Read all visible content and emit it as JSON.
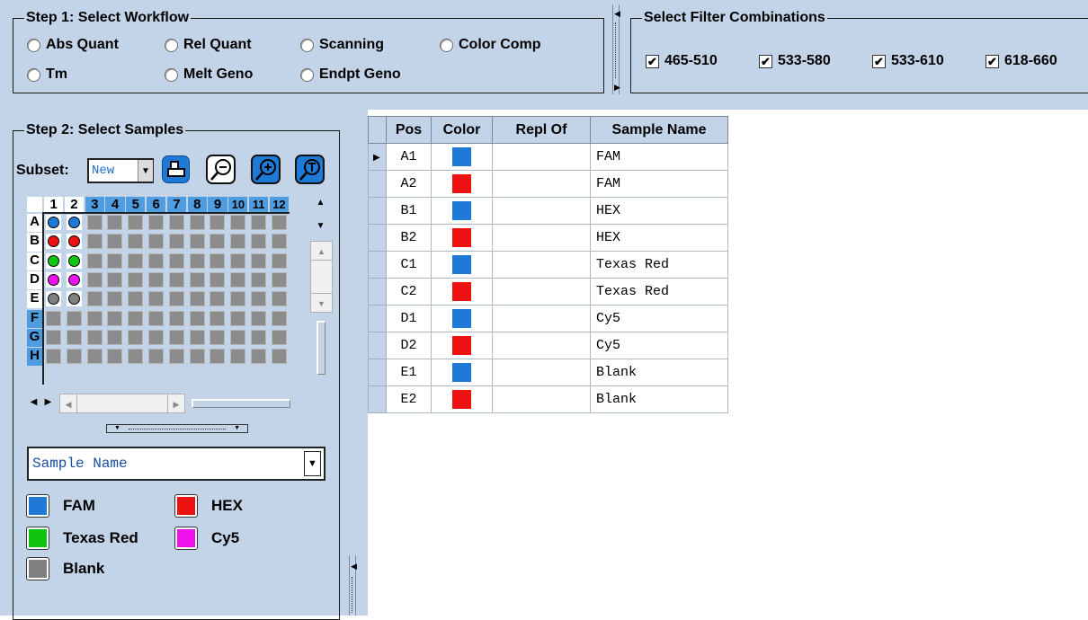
{
  "step1": {
    "title": "Step 1: Select Workflow",
    "options": [
      "Abs Quant",
      "Rel Quant",
      "Scanning",
      "Color Comp",
      "Tm",
      "Melt Geno",
      "Endpt Geno"
    ]
  },
  "filters": {
    "title": "Select Filter Combinations",
    "items": [
      {
        "label": "465-510",
        "checked": true
      },
      {
        "label": "533-580",
        "checked": true
      },
      {
        "label": "533-610",
        "checked": true
      },
      {
        "label": "618-660",
        "checked": true
      }
    ]
  },
  "step2": {
    "title": "Step 2: Select Samples",
    "subset_label": "Subset:",
    "subset_value": "New",
    "plate_columns": [
      "1",
      "2",
      "3",
      "4",
      "5",
      "6",
      "7",
      "8",
      "9",
      "10",
      "11",
      "12"
    ],
    "plate_rows": [
      "A",
      "B",
      "C",
      "D",
      "E",
      "F",
      "G",
      "H"
    ],
    "filled_wells": [
      {
        "row": "A",
        "col": 1,
        "color": "#1e7ad6"
      },
      {
        "row": "A",
        "col": 2,
        "color": "#1e7ad6"
      },
      {
        "row": "B",
        "col": 1,
        "color": "#ee1111"
      },
      {
        "row": "B",
        "col": 2,
        "color": "#ee1111"
      },
      {
        "row": "C",
        "col": 1,
        "color": "#11c411"
      },
      {
        "row": "C",
        "col": 2,
        "color": "#11c411"
      },
      {
        "row": "D",
        "col": 1,
        "color": "#ee11ee"
      },
      {
        "row": "D",
        "col": 2,
        "color": "#ee11ee"
      },
      {
        "row": "E",
        "col": 1,
        "color": "#808080"
      },
      {
        "row": "E",
        "col": 2,
        "color": "#808080"
      }
    ],
    "color_by": "Sample Name",
    "legend": [
      {
        "label": "FAM",
        "color": "#1e7ad6"
      },
      {
        "label": "HEX",
        "color": "#ee1111"
      },
      {
        "label": "Texas Red",
        "color": "#11c411"
      },
      {
        "label": "Cy5",
        "color": "#ee11ee"
      },
      {
        "label": "Blank",
        "color": "#808080"
      }
    ]
  },
  "table": {
    "columns": [
      "Pos",
      "Color",
      "Repl Of",
      "Sample Name"
    ],
    "rows": [
      {
        "pos": "A1",
        "color": "#1e7ad6",
        "repl": "",
        "name": "FAM"
      },
      {
        "pos": "A2",
        "color": "#ee1111",
        "repl": "",
        "name": "FAM"
      },
      {
        "pos": "B1",
        "color": "#1e7ad6",
        "repl": "",
        "name": "HEX"
      },
      {
        "pos": "B2",
        "color": "#ee1111",
        "repl": "",
        "name": "HEX"
      },
      {
        "pos": "C1",
        "color": "#1e7ad6",
        "repl": "",
        "name": "Texas Red"
      },
      {
        "pos": "C2",
        "color": "#ee1111",
        "repl": "",
        "name": "Texas Red"
      },
      {
        "pos": "D1",
        "color": "#1e7ad6",
        "repl": "",
        "name": "Cy5"
      },
      {
        "pos": "D2",
        "color": "#ee1111",
        "repl": "",
        "name": "Cy5"
      },
      {
        "pos": "E1",
        "color": "#1e7ad6",
        "repl": "",
        "name": "Blank"
      },
      {
        "pos": "E2",
        "color": "#ee1111",
        "repl": "",
        "name": "Blank"
      }
    ]
  }
}
